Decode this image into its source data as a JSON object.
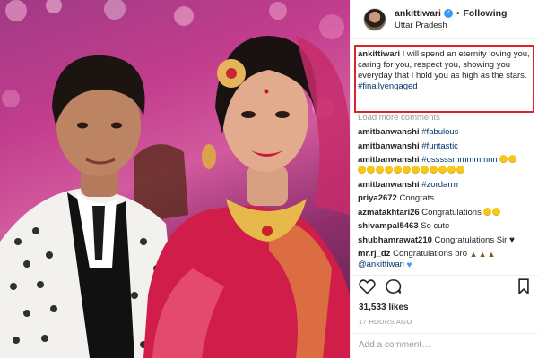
{
  "header": {
    "username": "ankittiwari",
    "follow_separator": "•",
    "follow_label": "Following",
    "location": "Uttar Pradesh"
  },
  "caption": {
    "username": "ankittiwari",
    "text": " I will spend an eternity loving you, caring for you, respect you, showing you everyday that I hold you as high as the stars.",
    "hashtag": "#finallyengaged"
  },
  "load_more_label": "Load more comments",
  "comments": [
    {
      "user": "amitbanwanshi",
      "text": "#fabulous",
      "is_tag": true
    },
    {
      "user": "amitbanwanshi",
      "text": "#funtastic",
      "is_tag": true
    },
    {
      "user": "amitbanwanshi",
      "text": "#osssssmmmmmnn",
      "is_tag": true
    },
    {
      "user": "amitbanwanshi",
      "text": "#zordarrrr",
      "is_tag": true
    },
    {
      "user": "priya2672",
      "text": "Congrats"
    },
    {
      "user": "azmatakhtari26",
      "text": "Congratulations"
    },
    {
      "user": "shivampal5463",
      "text": "So cute"
    },
    {
      "user": "shubhamrawat210",
      "text": "Congratulations Sir"
    },
    {
      "user": "mr.rj_dz",
      "text": "Congratulations bro",
      "mention": "@ankittiwari"
    }
  ],
  "icons": {
    "like": "heart-outline-icon",
    "comment": "comment-bubble-icon",
    "bookmark": "bookmark-icon"
  },
  "likes_text": "31,533 likes",
  "timestamp": "17 HOURS AGO",
  "add_comment": {
    "placeholder": "Add a comment…"
  },
  "colors": {
    "accent_link": "#003569",
    "verified_blue": "#3897f0",
    "highlight_box": "#d9232d",
    "muted_text": "#999999"
  }
}
